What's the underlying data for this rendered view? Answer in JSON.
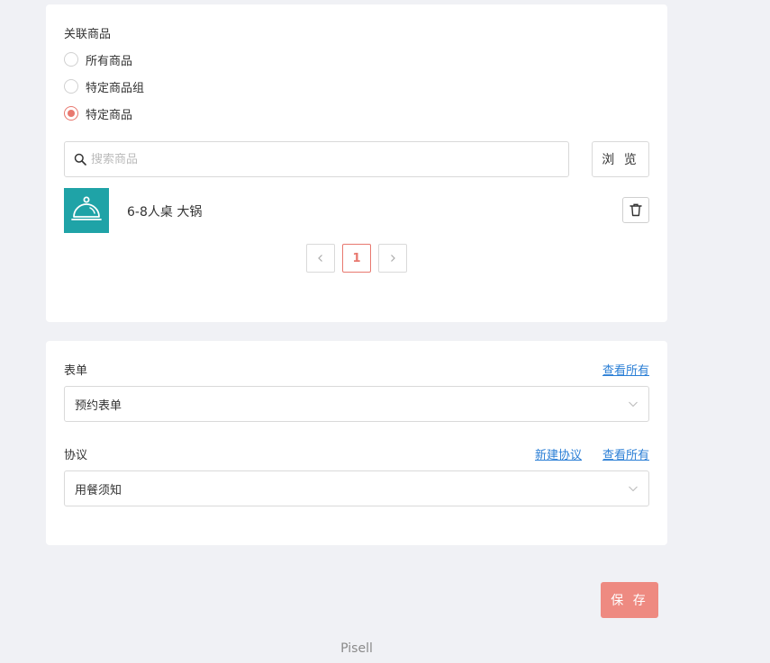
{
  "products_section": {
    "label": "关联商品",
    "options": [
      {
        "label": "所有商品",
        "checked": false
      },
      {
        "label": "特定商品组",
        "checked": false
      },
      {
        "label": "特定商品",
        "checked": true
      }
    ],
    "search": {
      "placeholder": "搜索商品",
      "value": ""
    },
    "browse_label": "浏 览",
    "items": [
      {
        "name": "6-8人桌 大锅",
        "icon": "cloche-icon"
      }
    ],
    "pagination": {
      "current_page": "1",
      "prev_icon": "chevron-left-icon",
      "next_icon": "chevron-right-icon"
    }
  },
  "form_section": {
    "form_label": "表单",
    "form_view_all": "查看所有",
    "form_value": "预约表单",
    "agreement_label": "协议",
    "agreement_new": "新建协议",
    "agreement_view_all": "查看所有",
    "agreement_value": "用餐须知"
  },
  "save_label": "保 存",
  "footer_text": "Pisell",
  "colors": {
    "accent": "#e8786f",
    "save_button": "#ee8a81",
    "link": "#2b7fd6",
    "thumb_bg": "#1fa3a7",
    "page_bg": "#f0f1f5"
  }
}
